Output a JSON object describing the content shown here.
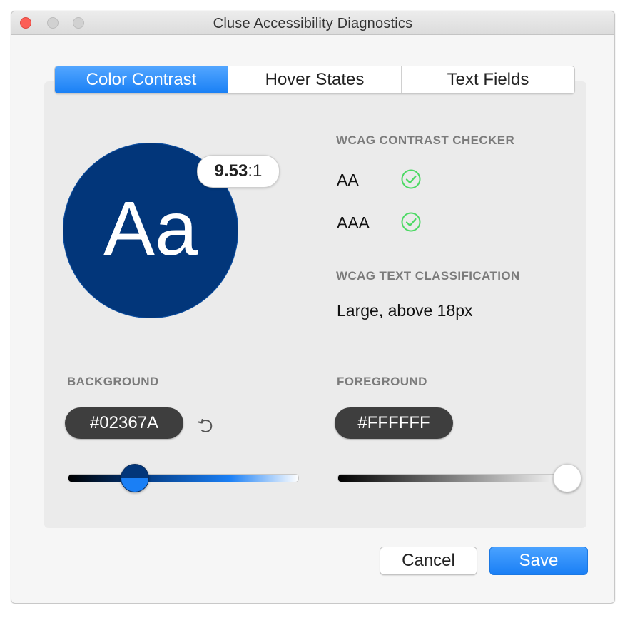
{
  "window": {
    "title": "Cluse Accessibility Diagnostics"
  },
  "tabs": [
    {
      "label": "Color Contrast",
      "active": true
    },
    {
      "label": "Hover States",
      "active": false
    },
    {
      "label": "Text Fields",
      "active": false
    }
  ],
  "preview": {
    "sample_text": "Aa",
    "ratio_main": "9.53",
    "ratio_suffix": ":1"
  },
  "wcag_checker": {
    "label": "WCAG CONTRAST CHECKER",
    "levels": [
      {
        "name": "AA",
        "status": "pass"
      },
      {
        "name": "AAA",
        "status": "pass"
      }
    ]
  },
  "classification": {
    "label": "WCAG TEXT CLASSIFICATION",
    "value": "Large, above 18px"
  },
  "background": {
    "label": "BACKGROUND",
    "hex": "#02367A",
    "slider_fraction": 0.29
  },
  "foreground": {
    "label": "FOREGROUND",
    "hex": "#FFFFFF",
    "slider_fraction": 1.0
  },
  "buttons": {
    "cancel": "Cancel",
    "save": "Save"
  },
  "colors": {
    "accent": "#1a7ff5",
    "sample_bg": "#02367A",
    "pass_green": "#4cd964",
    "pill_bg": "#3e3e3e"
  },
  "icons": {
    "pass": "check-circle-icon",
    "reset": "undo-icon"
  }
}
